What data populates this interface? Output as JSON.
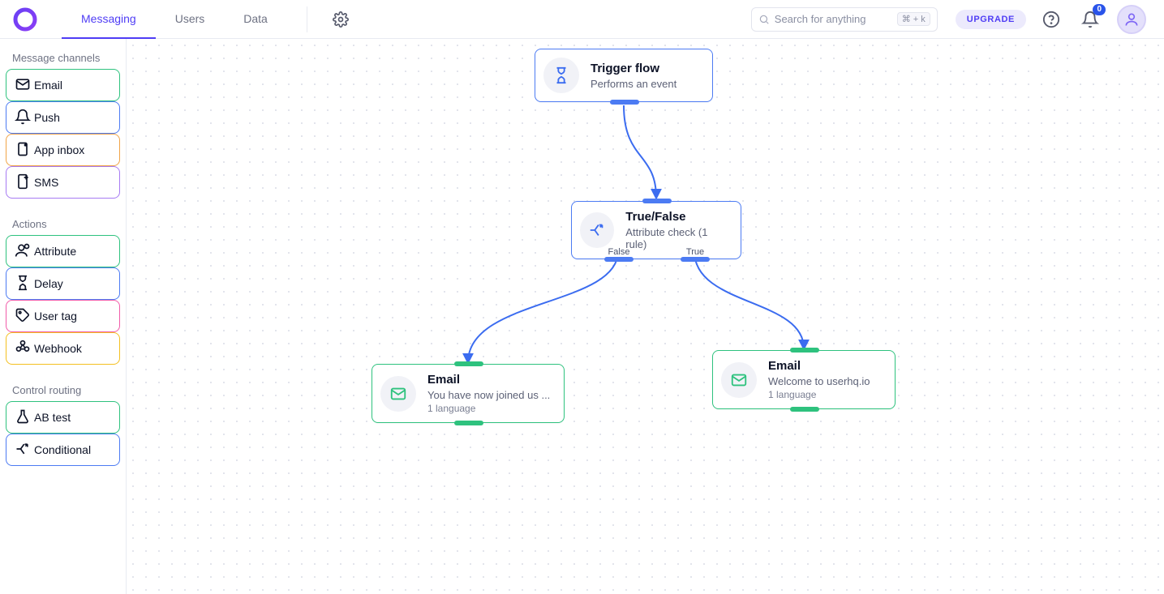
{
  "nav": {
    "tabs": [
      "Messaging",
      "Users",
      "Data"
    ],
    "active_tab_index": 0,
    "search_placeholder": "Search for anything",
    "search_kbd": "⌘ + k",
    "upgrade_label": "UPGRADE",
    "notif_count": "0"
  },
  "sidebar": {
    "groups": [
      {
        "title": "Message channels",
        "items": [
          {
            "label": "Email",
            "color": "c-green",
            "icon": "mail"
          },
          {
            "label": "Push",
            "color": "c-blue",
            "icon": "bell"
          },
          {
            "label": "App inbox",
            "color": "c-orange",
            "icon": "inbox"
          },
          {
            "label": "SMS",
            "color": "c-purple",
            "icon": "sms"
          }
        ]
      },
      {
        "title": "Actions",
        "items": [
          {
            "label": "Attribute",
            "color": "c-green",
            "icon": "user"
          },
          {
            "label": "Delay",
            "color": "c-blue",
            "icon": "hourglass"
          },
          {
            "label": "User tag",
            "color": "c-pink",
            "icon": "tag"
          },
          {
            "label": "Webhook",
            "color": "c-yellow",
            "icon": "hook"
          }
        ]
      },
      {
        "title": "Control routing",
        "items": [
          {
            "label": "AB test",
            "color": "c-green",
            "icon": "flask"
          },
          {
            "label": "Conditional",
            "color": "c-blue",
            "icon": "branch"
          }
        ]
      }
    ]
  },
  "flow": {
    "nodes": {
      "trigger": {
        "title": "Trigger flow",
        "subtitle": "Performs an event"
      },
      "cond": {
        "title": "True/False",
        "subtitle": "Attribute check (1 rule)",
        "port_false": "False",
        "port_true": "True"
      },
      "email_false": {
        "title": "Email",
        "subtitle": "You have now joined us ...",
        "meta": "1 language"
      },
      "email_true": {
        "title": "Email",
        "subtitle": "Welcome to userhq.io",
        "meta": "1 language"
      }
    }
  }
}
